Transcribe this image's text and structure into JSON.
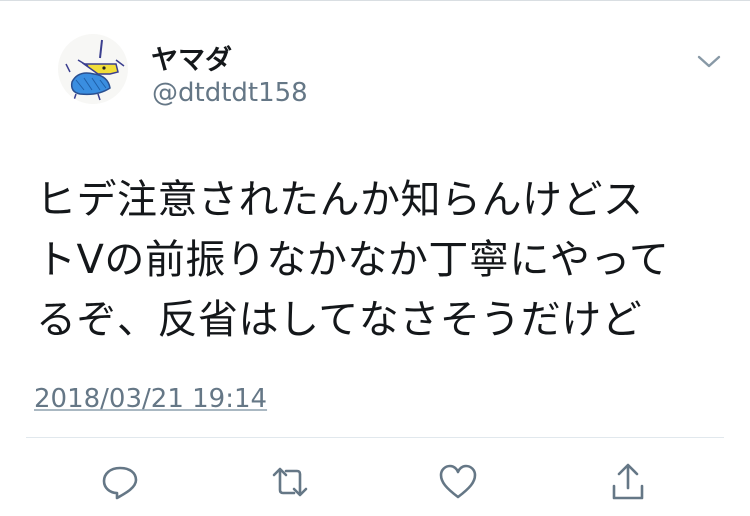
{
  "user": {
    "display_name": "ヤマダ",
    "username": "@dtdtdt158",
    "avatar_icon": "drawn-creature-avatar"
  },
  "tweet": {
    "text": "ヒデ注意されたんか知らんけどス\nトVの前振りなかなか丁寧にやって\nるぞ、反省はしてなさそうだけど",
    "timestamp": "2018/03/21 19:14"
  },
  "actions": [
    {
      "icon": "reply-icon"
    },
    {
      "icon": "retweet-icon"
    },
    {
      "icon": "like-icon"
    },
    {
      "icon": "share-icon"
    }
  ],
  "colors": {
    "text": "#14171a",
    "secondary": "#657786",
    "divider": "#e1e8ed"
  }
}
